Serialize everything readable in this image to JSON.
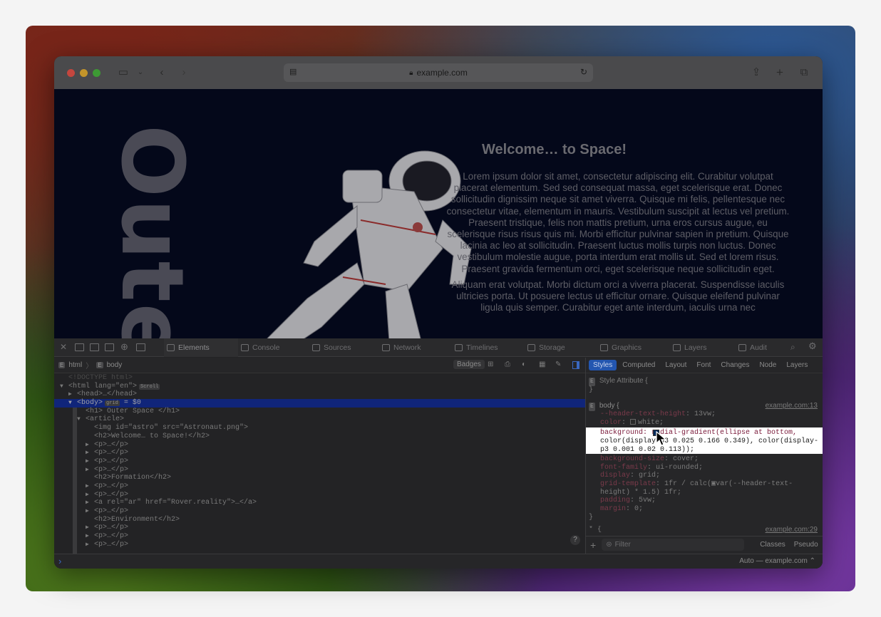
{
  "browser": {
    "url": "example.com"
  },
  "page": {
    "vertical_title": "Oute",
    "heading": "Welcome… to Space!",
    "paragraph1": "Lorem ipsum dolor sit amet, consectetur adipiscing elit. Curabitur volutpat placerat elementum. Sed sed consequat massa, eget scelerisque erat. Donec sollicitudin dignissim neque sit amet viverra. Quisque mi felis, pellentesque nec consectetur vitae, elementum in mauris. Vestibulum suscipit at lectus vel pretium. Praesent tristique, felis non mattis pretium, urna eros cursus augue, eu scelerisque risus risus quis mi. Morbi efficitur pulvinar sapien in pretium. Quisque lacinia ac leo at sollicitudin. Praesent luctus mollis turpis non luctus. Donec vestibulum molestie augue, porta interdum erat mollis ut. Sed et lorem risus. Praesent gravida fermentum orci, eget scelerisque neque sollicitudin eget.",
    "paragraph2": "Aliquam erat volutpat. Morbi dictum orci a viverra placerat. Suspendisse iaculis ultricies porta. Ut posuere lectus ut efficitur ornare. Quisque eleifend pulvinar ligula quis semper. Curabitur eget ante interdum, iaculis urna nec"
  },
  "devtools": {
    "tabs": [
      "Elements",
      "Console",
      "Sources",
      "Network",
      "Timelines",
      "Storage",
      "Graphics",
      "Layers",
      "Audit"
    ],
    "active_tab": "Elements",
    "breadcrumb": [
      "html",
      "body"
    ],
    "badges_label": "Badges",
    "sidebar_tabs": [
      "Styles",
      "Computed",
      "Layout",
      "Font",
      "Changes",
      "Node",
      "Layers"
    ],
    "elements": [
      {
        "indent": 0,
        "text": "<!DOCTYPE html>"
      },
      {
        "indent": 0,
        "tw": "▼",
        "text": "<html lang=\"en\">",
        "badge": "Scroll"
      },
      {
        "indent": 1,
        "tw": "▶",
        "text": "<head>…</head>"
      },
      {
        "indent": 1,
        "tw": "▼",
        "text": "<body>",
        "badge": "grid",
        "suffix": " = $0",
        "selected": true
      },
      {
        "indent": 2,
        "text": "<h1> Outer Space </h1>"
      },
      {
        "indent": 2,
        "tw": "▼",
        "text": "<article>"
      },
      {
        "indent": 3,
        "text": "<img id=\"astro\" src=\"Astronaut.png\">"
      },
      {
        "indent": 3,
        "text": "<h2>Welcome… to Space!</h2>"
      },
      {
        "indent": 3,
        "tw": "▶",
        "text": "<p>…</p>"
      },
      {
        "indent": 3,
        "tw": "▶",
        "text": "<p>…</p>"
      },
      {
        "indent": 3,
        "tw": "▶",
        "text": "<p>…</p>"
      },
      {
        "indent": 3,
        "tw": "▶",
        "text": "<p>…</p>"
      },
      {
        "indent": 3,
        "text": "<h2>Formation</h2>"
      },
      {
        "indent": 3,
        "tw": "▶",
        "text": "<p>…</p>"
      },
      {
        "indent": 3,
        "tw": "▶",
        "text": "<p>…</p>"
      },
      {
        "indent": 3,
        "tw": "▶",
        "text": "<a rel=\"ar\" href=\"Rover.reality\">…</a>"
      },
      {
        "indent": 3,
        "tw": "▶",
        "text": "<p>…</p>"
      },
      {
        "indent": 3,
        "text": "<h2>Environment</h2>"
      },
      {
        "indent": 3,
        "tw": "▶",
        "text": "<p>…</p>"
      },
      {
        "indent": 3,
        "tw": "▶",
        "text": "<p>…</p>"
      },
      {
        "indent": 3,
        "tw": "▶",
        "text": "<p>…</p>"
      }
    ],
    "styles": {
      "style_attribute": "Style Attribute {",
      "style_attribute_close": "}",
      "body_selector": "body {",
      "body_source": "example.com:13",
      "rules_before": [
        {
          "prop": "--header-text-height",
          "value": "13vw;"
        },
        {
          "prop": "color",
          "value": "white;",
          "swatch": "#ffffff"
        }
      ],
      "highlight_lines": [
        "background:   radial-gradient(ellipse at bottom,",
        "color(display-p3 0.025 0.166 0.349), color(display-",
        "p3 0.001 0.02 0.113));"
      ],
      "rules_after": [
        {
          "prop": "background-size",
          "value": "cover;"
        },
        {
          "prop": "font-family",
          "value": "ui-rounded;"
        },
        {
          "prop": "display",
          "value": "grid;"
        },
        {
          "prop": "grid-template",
          "value": "1fr / calc(▣var(--header-text-"
        },
        {
          "prop": "",
          "value": "height) * 1.5) 1fr;"
        },
        {
          "prop": "padding",
          "value": "5vw;"
        },
        {
          "prop": "margin",
          "value": "0;"
        }
      ],
      "close_brace": "}",
      "next_selector": "* {",
      "next_source": "example.com:29"
    },
    "filter_placeholder": "Filter",
    "classes_label": "Classes",
    "pseudo_label": "Pseudo",
    "console_prompt": "›",
    "console_context": "Auto — example.com ⌃",
    "help_label": "?"
  },
  "colors": {
    "traffic_red": "#c4463e",
    "traffic_yellow": "#c4952a",
    "traffic_green": "#3d9a34",
    "selection": "#10257a",
    "active_sidebar_tab": "#2356b0"
  }
}
